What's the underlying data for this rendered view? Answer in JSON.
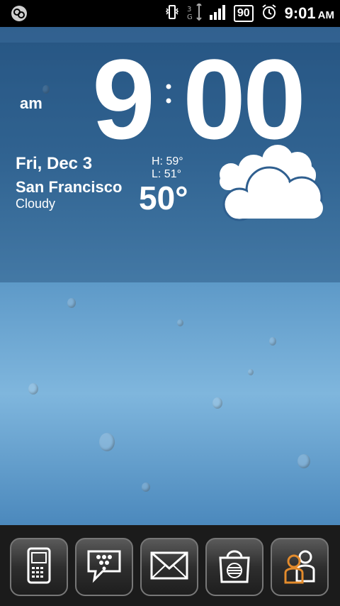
{
  "status_bar": {
    "battery": "90",
    "time": "9:01",
    "ampm": "AM"
  },
  "clock": {
    "ampm": "am",
    "hour": "9",
    "minutes": "00"
  },
  "weather": {
    "date": "Fri, Dec 3",
    "city": "San Francisco",
    "condition": "Cloudy",
    "high": "H:  59°",
    "low": "L:  51°",
    "temperature": "50°"
  },
  "dock": {
    "icons": [
      "blackberry-phone-icon",
      "bbm-chat-icon",
      "mail-icon",
      "att-store-icon",
      "contacts-icon"
    ]
  },
  "colors": {
    "status_bar": "#000000",
    "dock": "#1b1b1b",
    "accent_orange": "#e38b2c",
    "icon_blue": "#5aa9ff"
  }
}
